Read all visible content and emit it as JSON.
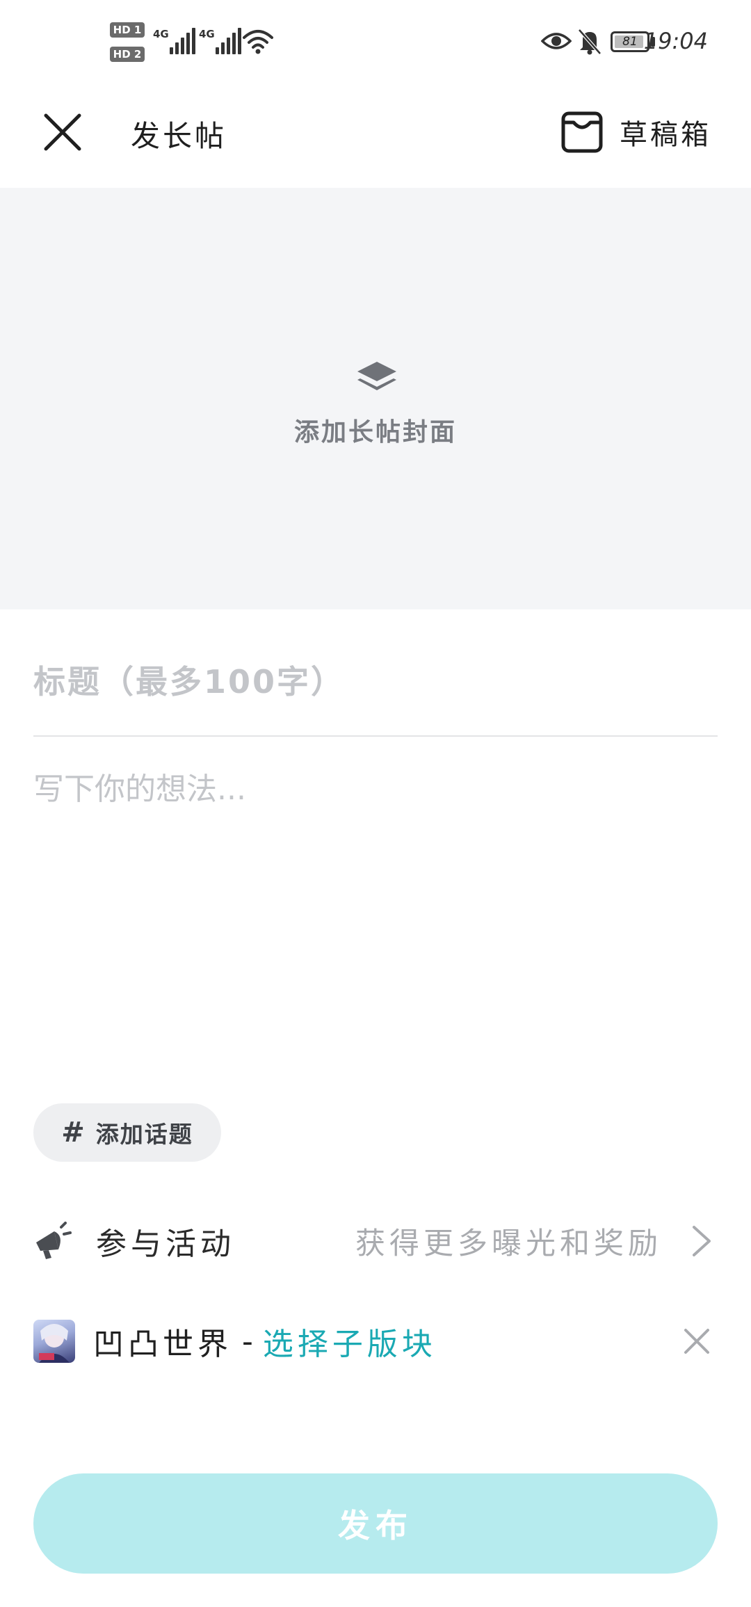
{
  "status_bar": {
    "hd1": "HD 1",
    "hd2": "HD 2",
    "net1": "4G",
    "net2": "4G",
    "battery": "81",
    "time": "19:04"
  },
  "header": {
    "title": "发长帖",
    "drafts_label": "草稿箱"
  },
  "cover": {
    "label": "添加长帖封面"
  },
  "editor": {
    "title_placeholder": "标题（最多100字）",
    "body_placeholder": "写下你的想法..."
  },
  "topic": {
    "label": "添加话题"
  },
  "activity": {
    "label": "参与活动",
    "hint": "获得更多曝光和奖励"
  },
  "forum": {
    "name": "凹凸世界",
    "separator": "-",
    "select_label": "选择子版块"
  },
  "publish": {
    "label": "发布"
  },
  "colors": {
    "accent": "#1aa9b3",
    "publish_disabled": "#b6ebee",
    "cover_bg": "#f4f5f7"
  }
}
